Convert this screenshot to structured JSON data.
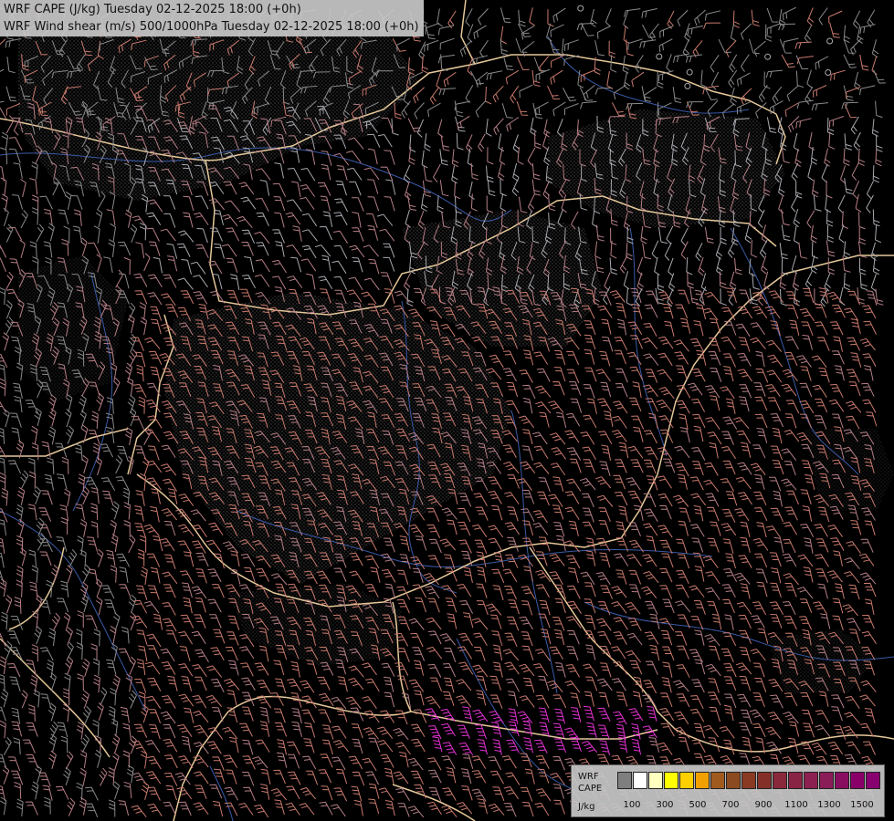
{
  "header": {
    "line1": "WRF CAPE (J/kg) Tuesday 02-12-2025 18:00 (+0h)",
    "line2": "WRF Wind shear (m/s) 500/1000hPa Tuesday 02-12-2025 18:00 (+0h)"
  },
  "legend": {
    "title_line1": "WRF",
    "title_line2": "CAPE",
    "unit": "J/kg",
    "swatch_colors": [
      "#7f7f7f",
      "#ffffff",
      "#ffffc0",
      "#ffff00",
      "#ffd000",
      "#f0a000",
      "#a05a1e",
      "#8c4a20",
      "#8a3a22",
      "#843028",
      "#88283a",
      "#8a2444",
      "#8c2050",
      "#8a1c58",
      "#880e60",
      "#880068",
      "#880070"
    ],
    "ticks": [
      "100",
      "300",
      "500",
      "700",
      "900",
      "1100",
      "1300",
      "1500"
    ]
  },
  "colors": {
    "background": "#000000",
    "border_line": "#e6c89a",
    "river": "#3a5aa8",
    "barb_grey": "#8a8a8a",
    "barb_lightgrey": "#a9a9b0",
    "barb_salmon": "#c97a6e",
    "barb_rose": "#b67f86",
    "barb_magenta": "#e432d2",
    "hatch_area": "#6a6a6a"
  }
}
